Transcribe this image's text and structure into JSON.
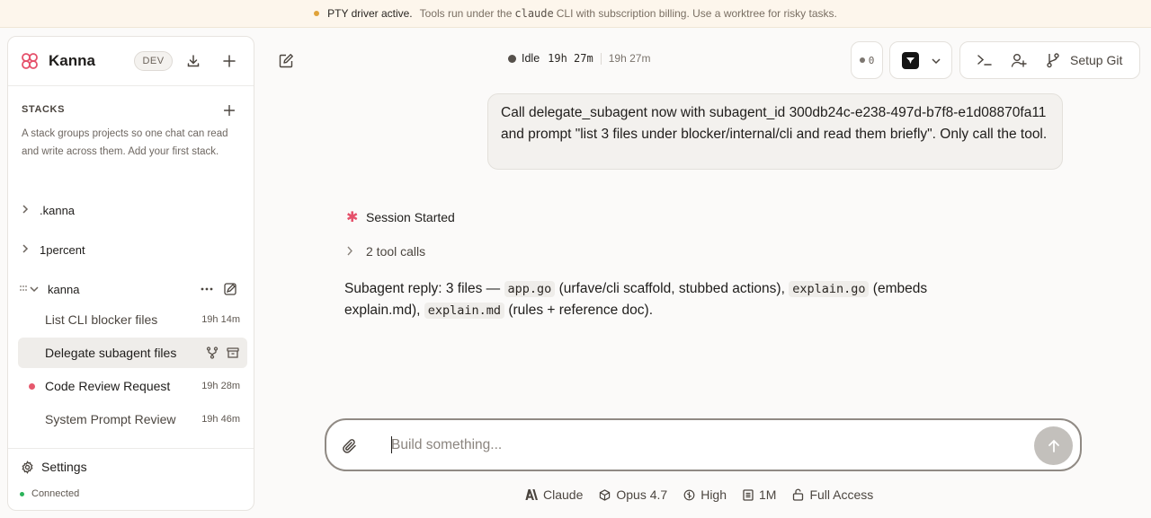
{
  "banner": {
    "title": "PTY driver active.",
    "text_before": "Tools run under the",
    "code": "claude",
    "text_after": "CLI with subscription billing. Use a worktree for risky tasks."
  },
  "sidebar": {
    "brand": "Kanna",
    "env_badge": "DEV",
    "stacks_title": "STACKS",
    "stacks_description": "A stack groups projects so one chat can read and write across them. Add your first stack.",
    "projects": [
      {
        "name": ".kanna"
      },
      {
        "name": "1percent"
      },
      {
        "name": "kanna"
      }
    ],
    "chats": [
      {
        "title": "List CLI blocker files",
        "time": "19h 14m"
      },
      {
        "title": "Delegate subagent files",
        "time": ""
      },
      {
        "title": "Code Review Request",
        "time": "19h 28m"
      },
      {
        "title": "System Prompt Review",
        "time": "19h 46m"
      }
    ],
    "settings_label": "Settings",
    "connection_status": "Connected"
  },
  "topbar": {
    "status": "Idle",
    "elapsed_mono": "19h 27m",
    "elapsed_secondary": "19h 27m",
    "queue_count": "0",
    "setup_git_label": "Setup Git"
  },
  "conversation": {
    "user_message": "Call delegate_subagent now with subagent_id 300db24c-e238-497d-b7f8-e1d08870fa11 and prompt \"list 3 files under blocker/internal/cli and read them briefly\". Only call the tool.",
    "session_started": "Session Started",
    "tool_calls": "2 tool calls",
    "reply": {
      "p1": "Subagent reply: 3 files —",
      "c1": "app.go",
      "p2": "(urfave/cli scaffold, stubbed actions),",
      "c2": "explain.go",
      "p3": "(embeds explain.md),",
      "c3": "explain.md",
      "p4": "(rules + reference doc)."
    }
  },
  "composer": {
    "placeholder": "Build something..."
  },
  "bottom_bar": {
    "provider": "Claude",
    "model": "Opus 4.7",
    "effort": "High",
    "context": "1M",
    "access": "Full Access"
  }
}
